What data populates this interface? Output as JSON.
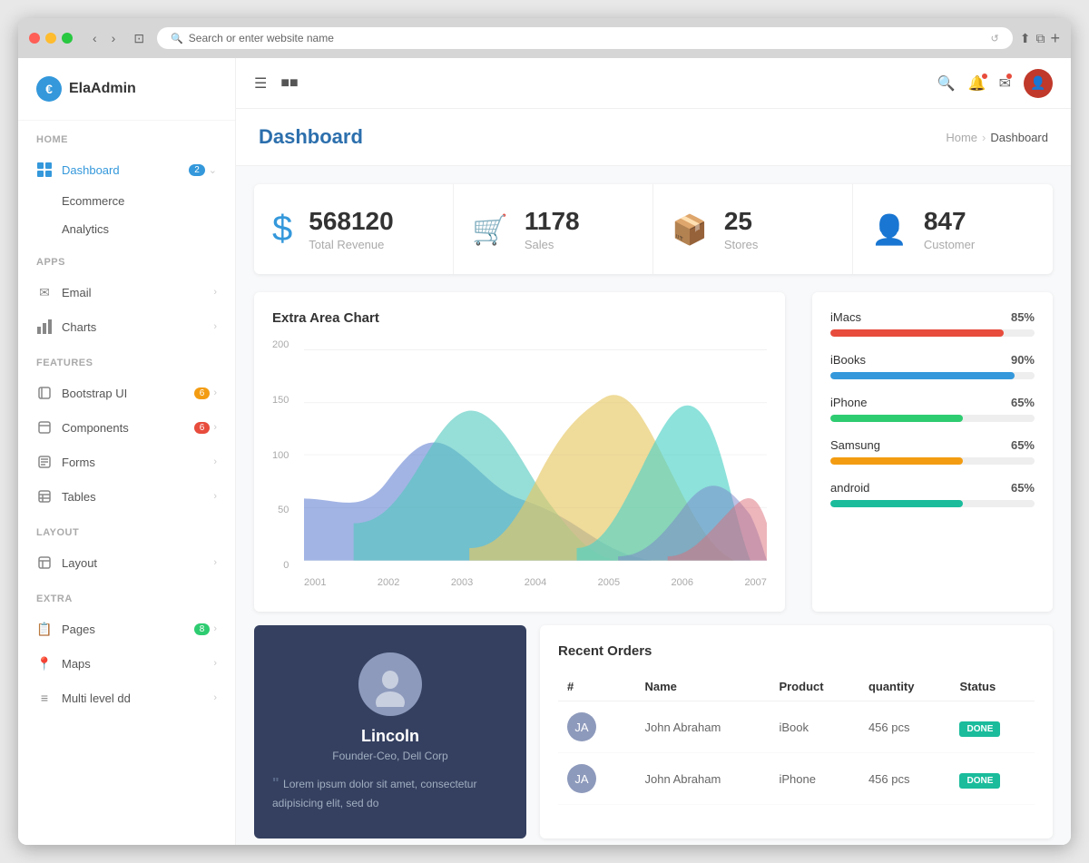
{
  "browser": {
    "address": "Search or enter website name"
  },
  "logo": {
    "text": "ElaAdmin",
    "icon": "€"
  },
  "sidebar": {
    "sections": [
      {
        "label": "HOME",
        "items": [
          {
            "id": "dashboard",
            "label": "Dashboard",
            "icon": "dashboard",
            "active": true,
            "badge": "2",
            "badge_color": "blue",
            "has_sub": true
          }
        ],
        "sub_items": [
          {
            "label": "Ecommerce",
            "active": false
          },
          {
            "label": "Analytics",
            "active": false
          }
        ]
      },
      {
        "label": "APPS",
        "items": [
          {
            "id": "email",
            "label": "Email",
            "icon": "email",
            "has_arrow": true
          },
          {
            "id": "charts",
            "label": "Charts",
            "icon": "charts",
            "has_arrow": true
          }
        ]
      },
      {
        "label": "FEATURES",
        "items": [
          {
            "id": "bootstrap-ui",
            "label": "Bootstrap UI",
            "icon": "bootstrap",
            "badge": "6",
            "badge_color": "orange",
            "has_arrow": true
          },
          {
            "id": "components",
            "label": "Components",
            "icon": "components",
            "badge": "6",
            "badge_color": "red",
            "has_arrow": true
          },
          {
            "id": "forms",
            "label": "Forms",
            "icon": "forms",
            "has_arrow": true
          },
          {
            "id": "tables",
            "label": "Tables",
            "icon": "tables",
            "has_arrow": true
          }
        ]
      },
      {
        "label": "LAYOUT",
        "items": [
          {
            "id": "layout",
            "label": "Layout",
            "icon": "layout",
            "has_arrow": true
          }
        ]
      },
      {
        "label": "EXTRA",
        "items": [
          {
            "id": "pages",
            "label": "Pages",
            "icon": "pages",
            "badge": "8",
            "badge_color": "green",
            "has_arrow": true
          },
          {
            "id": "maps",
            "label": "Maps",
            "icon": "maps",
            "has_arrow": true
          },
          {
            "id": "multilevel",
            "label": "Multi level dd",
            "icon": "multilevel",
            "has_arrow": true
          }
        ]
      }
    ]
  },
  "header": {
    "title": "Dashboard",
    "breadcrumb": [
      "Home",
      "Dashboard"
    ]
  },
  "stats": [
    {
      "id": "revenue",
      "icon": "$",
      "icon_class": "blue",
      "value": "568120",
      "label": "Total Revenue"
    },
    {
      "id": "sales",
      "icon": "🛒",
      "icon_class": "teal",
      "value": "1178",
      "label": "Sales"
    },
    {
      "id": "stores",
      "icon": "📦",
      "icon_class": "orange",
      "value": "25",
      "label": "Stores"
    },
    {
      "id": "customer",
      "icon": "👤",
      "icon_class": "pink",
      "value": "847",
      "label": "Customer"
    }
  ],
  "chart": {
    "title": "Extra Area Chart",
    "y_labels": [
      "200",
      "150",
      "100",
      "50",
      "0"
    ],
    "x_labels": [
      "2001",
      "2002",
      "2003",
      "2004",
      "2005",
      "2006",
      "2007"
    ]
  },
  "progress_bars": [
    {
      "label": "iMacs",
      "pct": 85,
      "color": "#e74c3c"
    },
    {
      "label": "iBooks",
      "pct": 90,
      "color": "#3498db"
    },
    {
      "label": "iPhone",
      "pct": 65,
      "color": "#2ecc71"
    },
    {
      "label": "Samsung",
      "pct": 65,
      "color": "#f39c12"
    },
    {
      "label": "android",
      "pct": 65,
      "color": "#1abc9c"
    }
  ],
  "profile": {
    "name": "Lincoln",
    "title": "Founder-Ceo, Dell Corp",
    "quote": "Lorem ipsum dolor sit amet, consectetur adipisicing elit, sed do"
  },
  "orders": {
    "title": "Recent Orders",
    "columns": [
      "#",
      "Name",
      "Product",
      "quantity",
      "Status"
    ],
    "rows": [
      {
        "id": 1,
        "name": "John Abraham",
        "product": "iBook",
        "quantity": "456 pcs",
        "status": "DONE"
      },
      {
        "id": 2,
        "name": "John Abraham",
        "product": "iPhone",
        "quantity": "456 pcs",
        "status": "DONE"
      }
    ]
  }
}
